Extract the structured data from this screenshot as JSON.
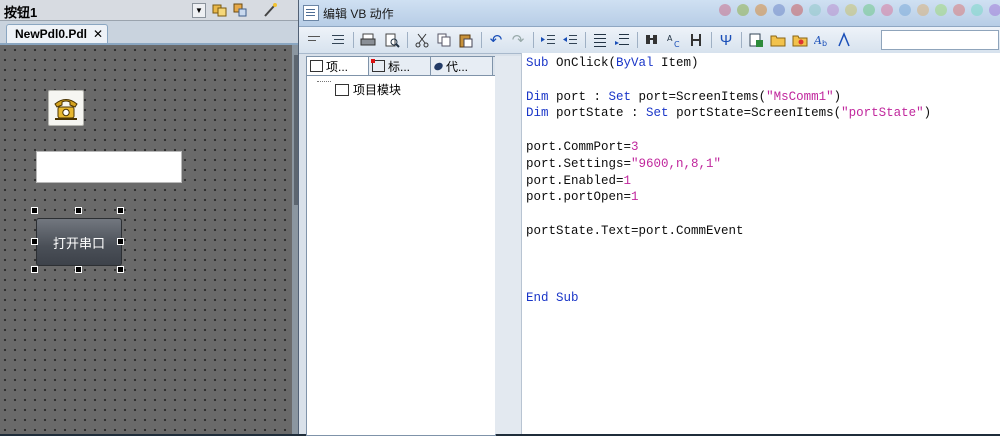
{
  "designer": {
    "object_name": "按钮1",
    "doc_tab": "NewPdl0.Pdl",
    "close_symbol": "✕",
    "button_label": "打开串口"
  },
  "editor": {
    "title": "编辑 VB 动作",
    "tabs": [
      "项...",
      "标...",
      "代..."
    ],
    "tree_item": "项目模块",
    "code_lines": [
      [
        {
          "t": "Sub",
          "c": "kw"
        },
        {
          "t": " OnClick("
        },
        {
          "t": "ByVal",
          "c": "kw"
        },
        {
          "t": " Item)"
        }
      ],
      [],
      [
        {
          "t": "Dim",
          "c": "kw"
        },
        {
          "t": " port : "
        },
        {
          "t": "Set",
          "c": "kw"
        },
        {
          "t": " port=ScreenItems("
        },
        {
          "t": "\"MsComm1\"",
          "c": "str"
        },
        {
          "t": ")"
        }
      ],
      [
        {
          "t": "Dim",
          "c": "kw"
        },
        {
          "t": " portState : "
        },
        {
          "t": "Set",
          "c": "kw"
        },
        {
          "t": " portState=ScreenItems("
        },
        {
          "t": "\"portState\"",
          "c": "str"
        },
        {
          "t": ")"
        }
      ],
      [],
      [
        {
          "t": "port.CommPort="
        },
        {
          "t": "3",
          "c": "num"
        }
      ],
      [
        {
          "t": "port.Settings="
        },
        {
          "t": "\"9600,n,8,1\"",
          "c": "str"
        }
      ],
      [
        {
          "t": "port.Enabled="
        },
        {
          "t": "1",
          "c": "num"
        }
      ],
      [
        {
          "t": "port.portOpen="
        },
        {
          "t": "1",
          "c": "num"
        }
      ],
      [],
      [
        {
          "t": "portState.Text=port.CommEvent"
        }
      ],
      [],
      [],
      [],
      [
        {
          "t": "End Sub",
          "c": "kw"
        }
      ]
    ]
  },
  "colors": {
    "keyword": "#1a36c8",
    "string": "#c0279d",
    "canvas": "#6a6a6a"
  }
}
